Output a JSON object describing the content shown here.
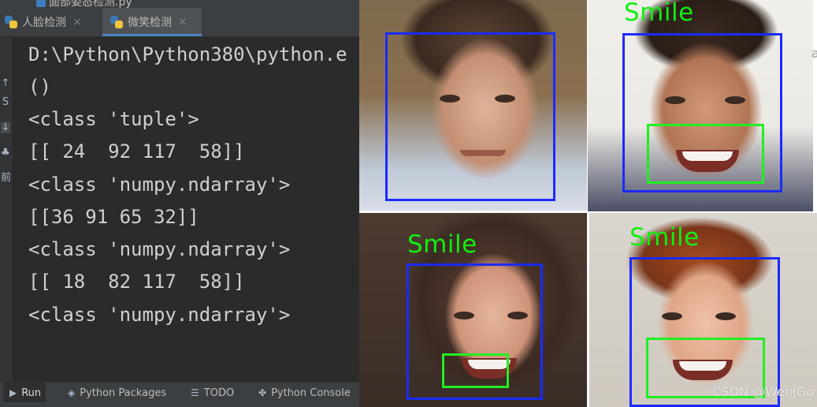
{
  "ide": {
    "partial_file_tab": "面部姿态检测.py",
    "tabs": [
      {
        "label": "人脸检测",
        "close": "×",
        "active": false
      },
      {
        "label": "微笑检测",
        "close": "×",
        "active": true
      }
    ],
    "gutter_glyphs": [
      "↑",
      "S",
      "↓",
      "♣",
      "前"
    ],
    "console_lines": [
      "D:\\Python\\Python380\\python.e",
      "()",
      "<class 'tuple'>",
      "[[ 24  92 117  58]]",
      "<class 'numpy.ndarray'>",
      "[[36 91 65 32]]",
      "<class 'numpy.ndarray'>",
      "[[ 18  82 117  58]]",
      "<class 'numpy.ndarray'>"
    ],
    "bottom_tabs": [
      {
        "label": "Run",
        "icon": "run-icon",
        "active": true
      },
      {
        "label": "Python Packages",
        "icon": "packages-icon",
        "active": false
      },
      {
        "label": "TODO",
        "icon": "list-icon",
        "active": false
      },
      {
        "label": "Python Console",
        "icon": "python-icon",
        "active": false
      }
    ]
  },
  "image_panel": {
    "smile_label": "Smile",
    "edge_text": "a",
    "watermark": "CSDN @WenJGo",
    "colors": {
      "face_box": "#1a2bff",
      "smile_box": "#22ee22",
      "smile_text": "#11ee11"
    }
  }
}
